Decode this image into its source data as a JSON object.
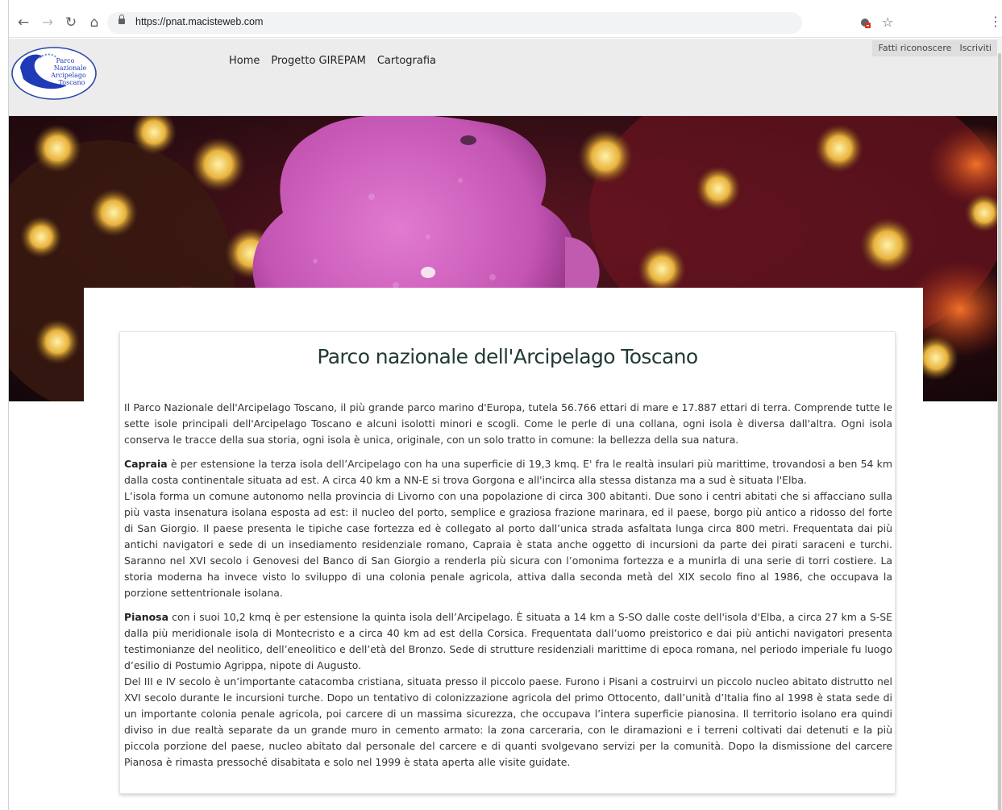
{
  "browser": {
    "url": "https://pnat.macisteweb.com"
  },
  "header": {
    "logo_text": [
      "Parco",
      "Nazionale",
      "Arcipelago",
      "Toscano"
    ],
    "nav": [
      "Home",
      "Progetto GIREPAM",
      "Cartografia"
    ],
    "user_links": [
      "Fatti riconoscere",
      "Iscriviti"
    ]
  },
  "content": {
    "title": "Parco nazionale dell'Arcipelago Toscano",
    "intro": "Il Parco Nazionale dell'Arcipelago Toscano, il più grande parco marino d'Europa, tutela 56.766 ettari di mare e 17.887 ettari di terra. Comprende tutte le sette isole principali dell'Arcipelago Toscano e alcuni isolotti minori e scogli. Come le perle di una collana, ogni isola è diversa dall'altra. Ogni isola conserva le tracce della sua storia, ogni isola è unica, originale, con un solo tratto in comune: la bellezza della sua natura.",
    "capraia_name": "Capraia",
    "capraia_text1": " è per estensione la terza isola dell’Arcipelago con ha una superficie di 19,3 kmq. E' fra le realtà insulari più marittime, trovandosi a ben 54 km dalla costa continentale situata ad est. A circa 40 km a NN-E si trova Gorgona e all'incirca alla stessa distanza ma a sud è situata l'Elba.",
    "capraia_text2": "L’isola forma un comune autonomo nella provincia di Livorno con una popolazione di circa 300 abitanti. Due sono i centri abitati che si affacciano sulla più vasta insenatura isolana esposta ad est: il nucleo del porto, semplice e graziosa frazione marinara, ed il paese, borgo più antico a ridosso del forte di San Giorgio. Il paese presenta le tipiche case fortezza ed è collegato al porto dall’unica strada asfaltata lunga circa 800 metri. Frequentata dai più antichi navigatori e sede di un insediamento residenziale romano, Capraia è stata anche oggetto di incursioni da parte dei pirati saraceni e turchi. Saranno nel XVI secolo i Genovesi del Banco di San Giorgio a renderla più sicura con l’omonima fortezza e a munirla di una serie di torri costiere. La storia moderna ha invece visto lo sviluppo di una colonia penale agricola, attiva dalla seconda metà del XIX secolo fino al 1986, che occupava la porzione settentrionale isolana.",
    "pianosa_name": "Pianosa",
    "pianosa_text1": " con i suoi 10,2 kmq è per estensione la quinta isola dell’Arcipelago. È situata a 14 km a S-SO dalle coste dell'isola d'Elba, a circa 27 km a S-SE dalla più meridionale isola di Montecristo e a circa 40 km ad est della Corsica. Frequentata dall’uomo preistorico e dai più antichi navigatori presenta testimonianze del neolitico, dell’eneolitico e dell’età del Bronzo. Sede di strutture residenziali marittime di epoca romana, nel periodo imperiale fu luogo d’esilio di Postumio Agrippa, nipote di Augusto.",
    "pianosa_text2": "Del III e IV secolo è un’importante catacomba cristiana, situata presso il piccolo paese. Furono i Pisani a costruirvi un piccolo nucleo abitato distrutto nel XVI secolo durante le incursioni turche. Dopo un tentativo di colonizzazione agricola del primo Ottocento, dall’unità d’Italia fino al 1998 è stata sede di un importante colonia penale agricola, poi carcere di un massima sicurezza, che occupava l’intera superficie pianosina. Il territorio isolano era quindi diviso in due realtà separate da un grande muro in cemento armato: la zona carceraria, con le diramazioni e i terreni coltivati dai detenuti e la più piccola porzione del paese, nucleo abitato dal personale del carcere e di quanti svolgevano servizi per la comunità. Dopo la dismissione del carcere Pianosa è rimasta pressoché disabitata e solo nel 1999 è stata aperta alle visite guidate."
  }
}
